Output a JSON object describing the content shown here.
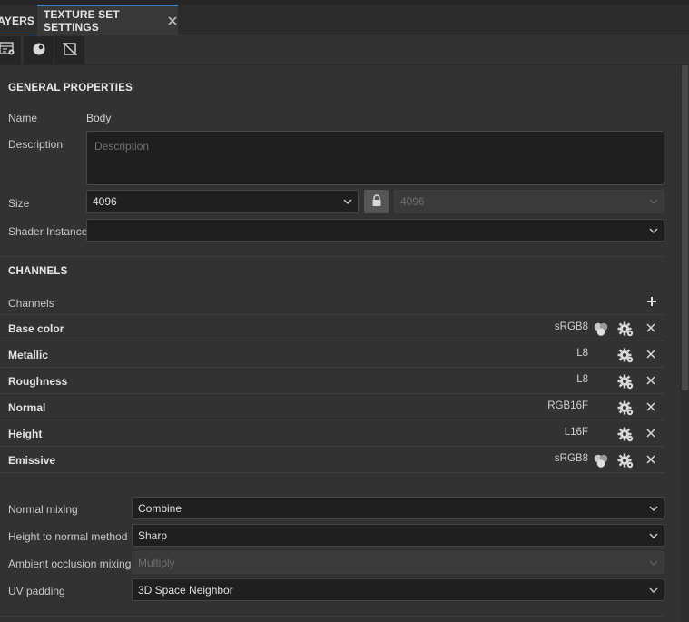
{
  "tabs": [
    {
      "label": "LAYERS"
    },
    {
      "label": "TEXTURE SET SETTINGS"
    }
  ],
  "toolbar": {
    "icons": [
      "texture-set-settings-icon",
      "material-sphere-icon",
      "uv-frame-icon"
    ]
  },
  "general": {
    "title": "GENERAL PROPERTIES",
    "name_label": "Name",
    "name_value": "Body",
    "description_label": "Description",
    "description_placeholder": "Description",
    "size_label": "Size",
    "size_value": "4096",
    "size_linked_value": "4096",
    "shader_label": "Shader Instance",
    "shader_value": ""
  },
  "channels": {
    "title": "CHANNELS",
    "list_label": "Channels",
    "items": [
      {
        "name": "Base color",
        "format": "sRGB8",
        "has_mix_icon": true
      },
      {
        "name": "Metallic",
        "format": "L8",
        "has_mix_icon": false
      },
      {
        "name": "Roughness",
        "format": "L8",
        "has_mix_icon": false
      },
      {
        "name": "Normal",
        "format": "RGB16F",
        "has_mix_icon": false
      },
      {
        "name": "Height",
        "format": "L16F",
        "has_mix_icon": false
      },
      {
        "name": "Emissive",
        "format": "sRGB8",
        "has_mix_icon": true
      }
    ]
  },
  "mixing": {
    "normal_mixing_label": "Normal mixing",
    "normal_mixing_value": "Combine",
    "height_to_normal_label": "Height to normal method",
    "height_to_normal_value": "Sharp",
    "ao_mixing_label": "Ambient occlusion mixing",
    "ao_mixing_value": "Multiply",
    "uv_padding_label": "UV padding",
    "uv_padding_value": "3D Space Neighbor"
  },
  "colors": {
    "accent": "#3b7fc4",
    "panel_bg": "#323232",
    "field_bg": "#1f1f1f"
  }
}
